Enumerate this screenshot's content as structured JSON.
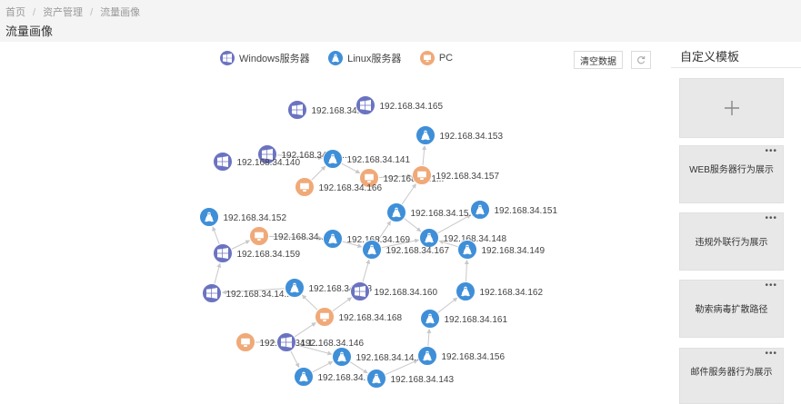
{
  "breadcrumb": {
    "items": [
      "首页",
      "资产管理",
      "流量画像"
    ],
    "separator": "/"
  },
  "page": {
    "title": "流量画像"
  },
  "legend": [
    {
      "label": "Windows服务器",
      "icon": "windows-icon",
      "color": "#6b73c1"
    },
    {
      "label": "Linux服务器",
      "icon": "linux-icon",
      "color": "#3f8fd8"
    },
    {
      "label": "PC",
      "icon": "pc-icon",
      "color": "#f0a978"
    }
  ],
  "toolbar": {
    "clear_label": "清空数据",
    "refresh_icon": "refresh-icon"
  },
  "colors": {
    "windows": "#6b73c1",
    "linux": "#3f8fd8",
    "pc": "#f0a978",
    "edge": "#c8c8c8"
  },
  "graph": {
    "nodes": [
      {
        "id": "w-top-a",
        "type": "windows",
        "label": "192.168.34.1..."
      },
      {
        "id": "w165",
        "type": "windows",
        "label": "192.168.34.165"
      },
      {
        "id": "l153",
        "type": "linux",
        "label": "192.168.34.153"
      },
      {
        "id": "w-mid",
        "type": "windows",
        "label": "192.168.34.15..."
      },
      {
        "id": "l141",
        "type": "linux",
        "label": "192.168.34.141"
      },
      {
        "id": "w140",
        "type": "windows",
        "label": "192.168.34.140"
      },
      {
        "id": "p-top",
        "type": "pc",
        "label": "192.168.34.1..."
      },
      {
        "id": "p157",
        "type": "pc",
        "label": "192.168.34.157"
      },
      {
        "id": "p166",
        "type": "pc",
        "label": "192.168.34.166"
      },
      {
        "id": "l152",
        "type": "linux",
        "label": "192.168.34.152"
      },
      {
        "id": "l15x",
        "type": "linux",
        "label": "192.168.34.15..."
      },
      {
        "id": "l151",
        "type": "linux",
        "label": "192.168.34.151"
      },
      {
        "id": "p-mid",
        "type": "pc",
        "label": "192.168.34..."
      },
      {
        "id": "l169",
        "type": "linux",
        "label": "192.168.34.169"
      },
      {
        "id": "l148",
        "type": "linux",
        "label": "192.168.34.148"
      },
      {
        "id": "w159",
        "type": "windows",
        "label": "192.168.34.159"
      },
      {
        "id": "l167",
        "type": "linux",
        "label": "192.168.34.167"
      },
      {
        "id": "l149",
        "type": "linux",
        "label": "192.168.34.149"
      },
      {
        "id": "w14x",
        "type": "windows",
        "label": "192.168.34.14..."
      },
      {
        "id": "l-mid",
        "type": "linux",
        "label": "192.168.34.163"
      },
      {
        "id": "w160",
        "type": "windows",
        "label": "192.168.34.160"
      },
      {
        "id": "l162",
        "type": "linux",
        "label": "192.168.34.162"
      },
      {
        "id": "p168",
        "type": "pc",
        "label": "192.168.34.168"
      },
      {
        "id": "l161",
        "type": "linux",
        "label": "192.168.34.161"
      },
      {
        "id": "p-bot",
        "type": "pc",
        "label": "192.168.34.1..."
      },
      {
        "id": "w146",
        "type": "windows",
        "label": "192.168.34.146"
      },
      {
        "id": "l14x",
        "type": "linux",
        "label": "192.168.34.14..."
      },
      {
        "id": "l156",
        "type": "linux",
        "label": "192.168.34.156"
      },
      {
        "id": "l-botl",
        "type": "linux",
        "label": "192.168.34.14..."
      },
      {
        "id": "l143",
        "type": "linux",
        "label": "192.168.34.143"
      }
    ],
    "edges": [
      [
        "p166",
        "l141"
      ],
      [
        "l141",
        "p-top"
      ],
      [
        "p-top",
        "p157"
      ],
      [
        "p157",
        "l153"
      ],
      [
        "l15x",
        "p157"
      ],
      [
        "l15x",
        "l148"
      ],
      [
        "l167",
        "l15x"
      ],
      [
        "l169",
        "l167"
      ],
      [
        "l167",
        "l148"
      ],
      [
        "l148",
        "l151"
      ],
      [
        "l149",
        "l148"
      ],
      [
        "l162",
        "l149"
      ],
      [
        "l161",
        "l162"
      ],
      [
        "l156",
        "l161"
      ],
      [
        "l143",
        "l156"
      ],
      [
        "l14x",
        "l143"
      ],
      [
        "l-botl",
        "l14x"
      ],
      [
        "w146",
        "l-botl"
      ],
      [
        "w146",
        "l14x"
      ],
      [
        "p-bot",
        "w146"
      ],
      [
        "w146",
        "p168"
      ],
      [
        "p168",
        "w160"
      ],
      [
        "w160",
        "l167"
      ],
      [
        "p168",
        "l-mid"
      ],
      [
        "l-mid",
        "w14x"
      ],
      [
        "p-mid",
        "l169"
      ],
      [
        "w159",
        "p-mid"
      ],
      [
        "w159",
        "l152"
      ],
      [
        "w14x",
        "w159"
      ],
      [
        "w-mid",
        "l141"
      ]
    ]
  },
  "templates": {
    "title": "自定义模板",
    "add_icon": "plus-icon",
    "more_icon": "more-icon",
    "items": [
      {
        "label": "WEB服务器行为展示"
      },
      {
        "label": "违规外联行为展示"
      },
      {
        "label": "勒索病毒扩散路径"
      },
      {
        "label": "邮件服务器行为展示"
      }
    ]
  }
}
